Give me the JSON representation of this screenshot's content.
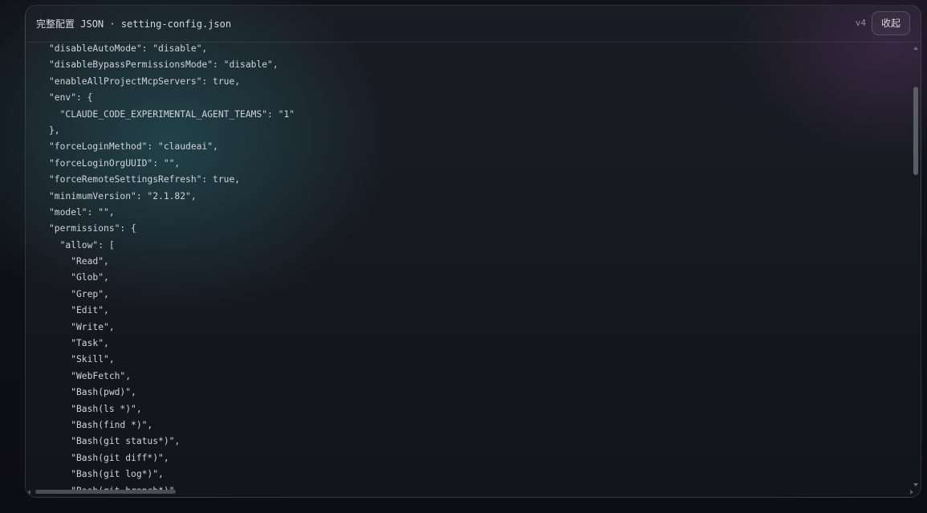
{
  "panel": {
    "title_prefix": "完整配置",
    "title_suffix": " JSON · setting-config.json",
    "version": "v4",
    "collapse_label": "收起"
  },
  "code_lines": [
    "\"disableAutoMode\": \"disable\",",
    "\"disableBypassPermissionsMode\": \"disable\",",
    "\"enableAllProjectMcpServers\": true,",
    "\"env\": {",
    "  \"CLAUDE_CODE_EXPERIMENTAL_AGENT_TEAMS\": \"1\"",
    "},",
    "\"forceLoginMethod\": \"claudeai\",",
    "\"forceLoginOrgUUID\": \"\",",
    "\"forceRemoteSettingsRefresh\": true,",
    "\"minimumVersion\": \"2.1.82\",",
    "\"model\": \"\",",
    "\"permissions\": {",
    "  \"allow\": [",
    "    \"Read\",",
    "    \"Glob\",",
    "    \"Grep\",",
    "    \"Edit\",",
    "    \"Write\",",
    "    \"Task\",",
    "    \"Skill\",",
    "    \"WebFetch\",",
    "    \"Bash(pwd)\",",
    "    \"Bash(ls *)\",",
    "    \"Bash(find *)\",",
    "    \"Bash(git status*)\",",
    "    \"Bash(git diff*)\",",
    "    \"Bash(git log*)\",",
    "    \"Bash(git branch*)\","
  ],
  "colors": {
    "teal_glow": "#28626a",
    "purple_glow": "#563460",
    "text": "#cfd3da"
  }
}
